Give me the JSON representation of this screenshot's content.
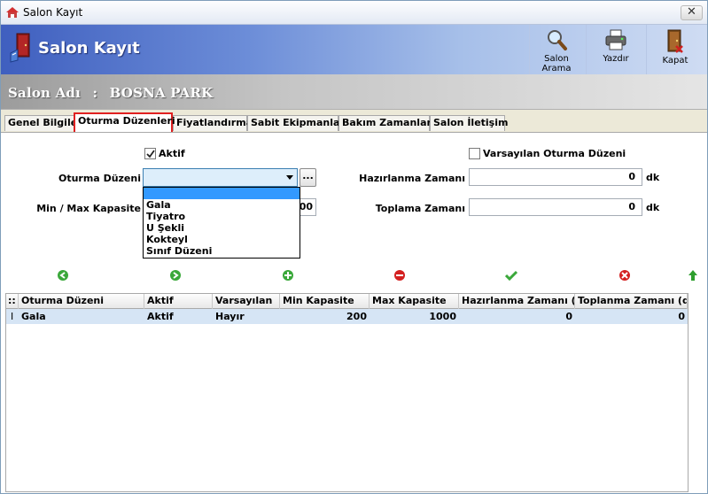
{
  "window": {
    "title": "Salon Kayıt",
    "close": "✕"
  },
  "header": {
    "title": "Salon Kayıt",
    "buttons": [
      {
        "label": "Salon Arama",
        "icon": "magnifier-icon"
      },
      {
        "label": "Yazdır",
        "icon": "printer-icon"
      },
      {
        "label": "Kapat",
        "icon": "exit-door-icon"
      }
    ]
  },
  "salon": {
    "label": "Salon Adı",
    "separator": ":",
    "name": "BOSNA PARK"
  },
  "tabs": [
    {
      "label": "Genel Bilgiler",
      "active": false
    },
    {
      "label": "Oturma Düzenleri",
      "active": true
    },
    {
      "label": "Fiyatlandırma",
      "active": false
    },
    {
      "label": "Sabit Ekipmanlar",
      "active": false
    },
    {
      "label": "Bakım Zamanları",
      "active": false
    },
    {
      "label": "Salon İletişim",
      "active": false
    }
  ],
  "form": {
    "aktif_label": "Aktif",
    "aktif_checked": true,
    "varsayilan_label": "Varsayılan Oturma Düzeni",
    "varsayilan_checked": false,
    "oturma_label": "Oturma Düzeni",
    "oturma_value": "",
    "ellipsis": "...",
    "kapasite_label": "Min / Max Kapasite",
    "kapasite_visible_value": "00",
    "hazirlanma_label": "Hazırlanma Zamanı",
    "hazirlanma_value": "0",
    "toplama_label": "Toplama Zamanı",
    "toplama_value": "0",
    "unit": "dk"
  },
  "dropdown_options": [
    "",
    "Gala",
    "Tiyatro",
    "U Şekli",
    "Kokteyl",
    "Sınıf Düzeni"
  ],
  "actions": [
    {
      "name": "first-record",
      "icon": "arrow-left-green-icon",
      "color": "#2e9e2e"
    },
    {
      "name": "next-record",
      "icon": "arrow-right-green-icon",
      "color": "#2e9e2e"
    },
    {
      "name": "add-record",
      "icon": "plus-green-icon",
      "color": "#2e9e2e"
    },
    {
      "name": "delete-record",
      "icon": "minus-red-icon",
      "color": "#d42020"
    },
    {
      "name": "save-record",
      "icon": "check-green-icon",
      "color": "#3aa83a"
    },
    {
      "name": "cancel-record",
      "icon": "x-red-icon",
      "color": "#d42020"
    },
    {
      "name": "upload",
      "icon": "arrow-up-green-icon",
      "color": "#2e9e2e"
    }
  ],
  "grid": {
    "corner": "::",
    "columns": [
      "Oturma Düzeni",
      "Aktif",
      "Varsayılan",
      "Min Kapasite",
      "Max Kapasite",
      "Hazırlanma Zamanı (...",
      "Toplanma Zamanı (d..."
    ],
    "rows": [
      {
        "indicator": "I",
        "cells": [
          "Gala",
          "Aktif",
          "Hayır",
          "200",
          "1000",
          "0",
          "0"
        ]
      }
    ]
  }
}
